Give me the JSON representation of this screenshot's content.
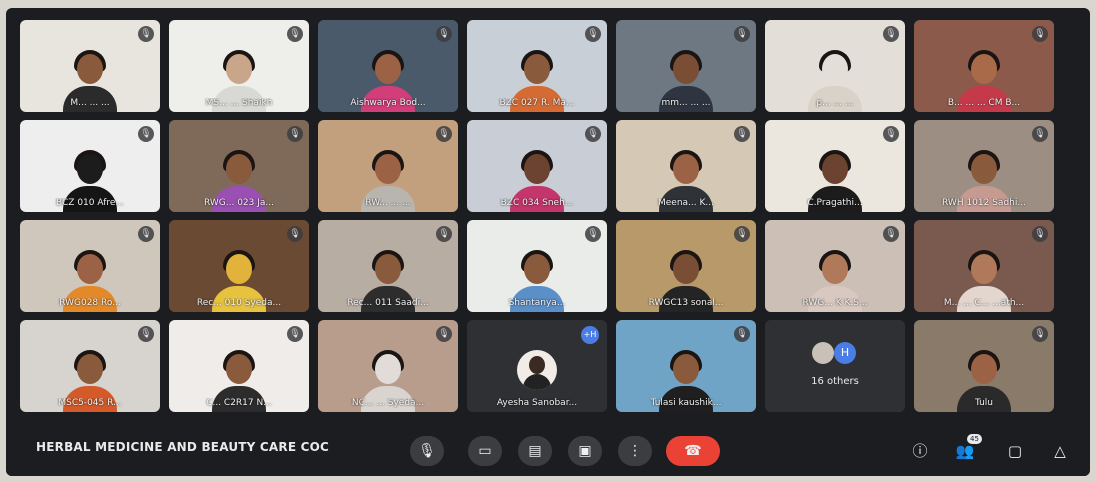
{
  "meeting": {
    "title": "HERBAL MEDICINE AND BEAUTY CARE COC"
  },
  "participants": [
    {
      "name": "M... ... ...",
      "bg": "#e8e4de",
      "skin": "#8a5a3c",
      "shirt": "#2b2b2b"
    },
    {
      "name": "MS... ... Shaikh",
      "bg": "#eeeeea",
      "skin": "#c9a58a",
      "shirt": "#d8d8d4"
    },
    {
      "name": "Aishwarya Bod...",
      "bg": "#4b5a6a",
      "skin": "#9b6245",
      "shirt": "#d13e7a"
    },
    {
      "name": "BZC 027 R. Ma...",
      "bg": "#c9cfd6",
      "skin": "#8a5a3c",
      "shirt": "#d56b33"
    },
    {
      "name": "mm... ... ...",
      "bg": "#6e7883",
      "skin": "#7a4e35",
      "shirt": "#2e3540"
    },
    {
      "name": "p... ... ...",
      "bg": "#e3dfd8",
      "skin": "#e3dfd8",
      "shirt": "#d8d2c8"
    },
    {
      "name": "B... ... ... CM B...",
      "bg": "#8b5a4a",
      "skin": "#a86a48",
      "shirt": "#c53a4a"
    },
    {
      "name": "BCZ 010 Afre...",
      "bg": "#efeeee",
      "skin": "#1c1c1c",
      "shirt": "#151515"
    },
    {
      "name": "RWG... 023 Ja...",
      "bg": "#7f6a5a",
      "skin": "#8a5a3c",
      "shirt": "#9a4fb3"
    },
    {
      "name": "RW... ... ...",
      "bg": "#c2a07d",
      "skin": "#9b6245",
      "shirt": "#b8b4ae"
    },
    {
      "name": "BZC 034 Sneh...",
      "bg": "#c9ced6",
      "skin": "#6b4330",
      "shirt": "#c4356b"
    },
    {
      "name": "Meena... K...",
      "bg": "#d5c8b5",
      "skin": "#9b6245",
      "shirt": "#2f3338"
    },
    {
      "name": "C.Pragathi...",
      "bg": "#ebe6de",
      "skin": "#6b4330",
      "shirt": "#1c1c1c"
    },
    {
      "name": "RWH 1012 Sadhi...",
      "bg": "#9c8e82",
      "skin": "#8a5a3c",
      "shirt": "#c59a90"
    },
    {
      "name": "RWG028 Ro...",
      "bg": "#cfc7bc",
      "skin": "#9b6245",
      "shirt": "#e3892a"
    },
    {
      "name": "Rec... 010 Syeda...",
      "bg": "#6b4a33",
      "skin": "#e1b33b",
      "shirt": "#e6c23f"
    },
    {
      "name": "Rec... 011 Saadi...",
      "bg": "#b8ada2",
      "skin": "#8a5a3c",
      "shirt": "#2d2d2d"
    },
    {
      "name": "Shantanya...",
      "bg": "#e9ece9",
      "skin": "#8a5a3c",
      "shirt": "#5a8fc8"
    },
    {
      "name": "RWGC13 sonal...",
      "bg": "#b89a6a",
      "skin": "#7a4e35",
      "shirt": "#242424"
    },
    {
      "name": "RWG... K K.S...",
      "bg": "#cbbfb6",
      "skin": "#b07a5a",
      "shirt": "#d9c8bf"
    },
    {
      "name": "M... ... C... ...ath...",
      "bg": "#7a5a4e",
      "skin": "#b07a5a",
      "shirt": "#e2d6cf"
    },
    {
      "name": "MSC5-045 R...",
      "bg": "#d7d3cf",
      "skin": "#8a5a3c",
      "shirt": "#d45a2a"
    },
    {
      "name": "C... C2R17 N...",
      "bg": "#efecea",
      "skin": "#8a5a3c",
      "shirt": "#2c2c2c"
    },
    {
      "name": "NC... ... Syeda...",
      "bg": "#b89c8c",
      "skin": "#e2dcd8",
      "shirt": "#d9d4cf"
    },
    {
      "name": "Ayesha Sanobar...",
      "bg": "#2f3034",
      "skin": "#2f3034",
      "shirt": "#2f3034"
    },
    {
      "name": "Tulasi kaushik...",
      "bg": "#6fa4c6",
      "skin": "#8a5a3c",
      "shirt": "#1f1f1f"
    },
    {
      "name": "16 others",
      "bg": "#2f3034",
      "skin": "#2f3034",
      "shirt": "#2f3034"
    },
    {
      "name": "Tulu",
      "bg": "#8a7a6a",
      "skin": "#9b6245",
      "shirt": "#2a2a2a"
    }
  ],
  "others": {
    "count_label": "16 others",
    "avatar_letter": "H"
  },
  "chat_badge": "+H",
  "controls": {
    "mic_icon": "mic-icon",
    "camera_icon": "camera-icon",
    "captions_icon": "captions-icon",
    "present_icon": "present-icon",
    "more_icon": "more-options-icon",
    "end_icon": "end-call-icon"
  },
  "side_controls": {
    "people_count": "45"
  }
}
